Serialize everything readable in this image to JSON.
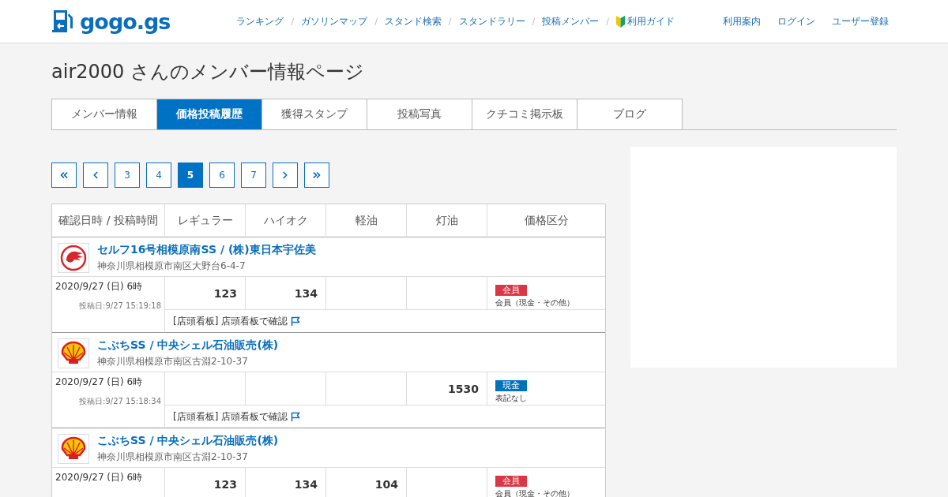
{
  "header": {
    "logo": "gogo.gs",
    "nav": [
      {
        "label": "ランキング"
      },
      {
        "separator": "/",
        "label": "ガソリンマップ"
      },
      {
        "separator": "/",
        "label": "スタンド検索"
      },
      {
        "separator": "/",
        "label": "スタンドラリー"
      },
      {
        "separator": "/",
        "label": "投稿メンバー"
      },
      {
        "separator": "/",
        "label": "利用ガイド",
        "icon": true
      }
    ],
    "links": [
      "利用案内",
      "ログイン",
      "ユーザー登録"
    ]
  },
  "title": "air2000 さんのメンバー情報ページ",
  "tabs": [
    {
      "label": "メンバー情報",
      "selected": false
    },
    {
      "label": "価格投稿履歴",
      "selected": true
    },
    {
      "label": "獲得スタンプ",
      "selected": false
    },
    {
      "label": "投稿写真",
      "selected": false
    },
    {
      "label": "クチコミ掲示板",
      "selected": false
    },
    {
      "label": "ブログ",
      "selected": false
    }
  ],
  "pagination": [
    {
      "kind": "first",
      "selected": false
    },
    {
      "kind": "prev",
      "selected": false
    },
    {
      "kind": "page",
      "label": "3",
      "selected": false
    },
    {
      "kind": "page",
      "label": "4",
      "selected": false
    },
    {
      "kind": "page",
      "label": "5",
      "selected": true
    },
    {
      "kind": "page",
      "label": "6",
      "selected": false
    },
    {
      "kind": "page",
      "label": "7",
      "selected": false
    },
    {
      "kind": "next",
      "selected": false
    },
    {
      "kind": "last",
      "selected": false
    }
  ],
  "table": {
    "columns": [
      "確認日時 / 投稿時間",
      "レギュラー",
      "ハイオク",
      "軽油",
      "灯油",
      "価格区分"
    ],
    "entries": [
      {
        "kind": "red-emblem",
        "station": "セルフ16号相模原南SS / (株)東日本宇佐美",
        "address": "神奈川県相模原市南区大野台6-4-7",
        "date": "2020/9/27 (日) 6時",
        "posted": "投稿日:9/27 15:19:18",
        "prices": {
          "regular": "123",
          "high_octane": "134"
        },
        "badge": {
          "label": "会員",
          "color": "#dc3545"
        },
        "category": "会員（現金・その他）",
        "source": "[店頭看板] 店頭看板で確認"
      },
      {
        "kind": "shell",
        "station": "こぶちSS / 中央シェル石油販売(株)",
        "address": "神奈川県相模原市南区古淵2-10-37",
        "date": "2020/9/27 (日) 6時",
        "posted": "投稿日:9/27 15:18:34",
        "prices": {
          "kerosene": "1530"
        },
        "badge": {
          "label": "現金",
          "color": "#0072bc"
        },
        "category": "表記なし",
        "source": "[店頭看板] 店頭看板で確認"
      },
      {
        "kind": "shell",
        "station": "こぶちSS / 中央シェル石油販売(株)",
        "address": "神奈川県相模原市南区古淵2-10-37",
        "date": "2020/9/27 (日) 6時",
        "prices": {
          "regular": "123",
          "high_octane": "134",
          "diesel": "104"
        },
        "badge": {
          "label": "会員",
          "color": "#dc3545"
        },
        "category": "会員（現金・その他）"
      }
    ]
  }
}
